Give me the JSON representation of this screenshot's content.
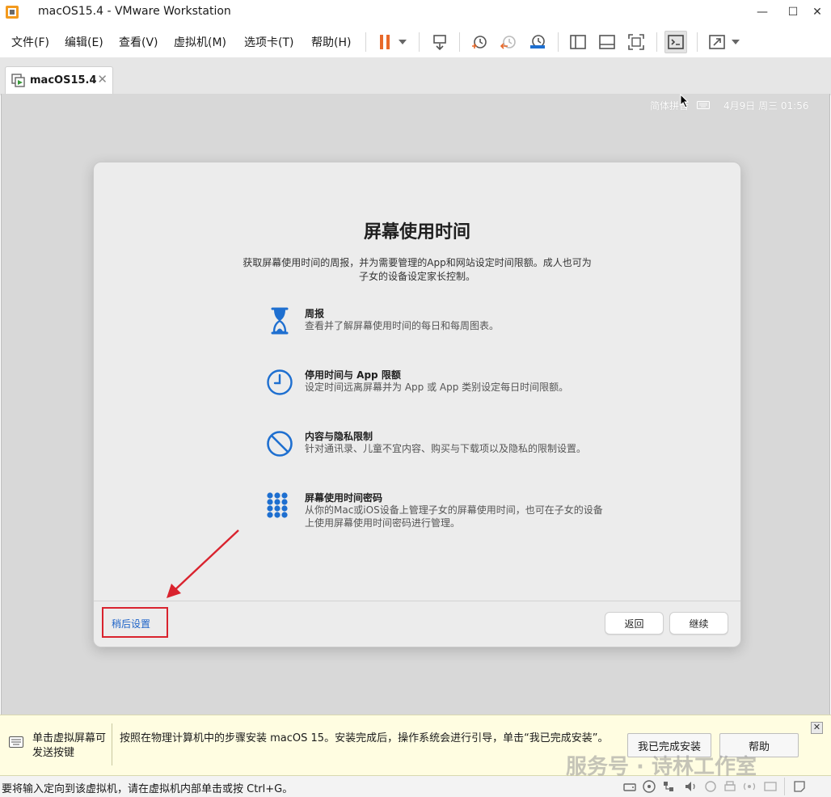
{
  "window": {
    "title": "macOS15.4 - VMware Workstation",
    "controls": {
      "minimize": "—",
      "maximize": "☐",
      "close": "✕"
    }
  },
  "menu": {
    "file": "文件(F)",
    "edit": "编辑(E)",
    "view": "查看(V)",
    "vm": "虚拟机(M)",
    "tabs": "选项卡(T)",
    "help": "帮助(H)"
  },
  "tab": {
    "label": "macOS15.4",
    "close": "✕"
  },
  "mac_status": {
    "input_method": "简体拼音",
    "datetime": "4月9日 周三 01:56"
  },
  "dialog": {
    "title": "屏幕使用时间",
    "description": "获取屏幕使用时间的周报，并为需要管理的App和网站设定时间限额。成人也可为子女的设备设定家长控制。",
    "features": [
      {
        "icon": "hourglass-icon",
        "title": "周报",
        "desc": "查看并了解屏幕使用时间的每日和每周图表。"
      },
      {
        "icon": "clock-icon",
        "title": "停用时间与 App 限额",
        "desc": "设定时间远离屏幕并为 App 或 App 类别设定每日时间限额。"
      },
      {
        "icon": "prohibited-icon",
        "title": "内容与隐私限制",
        "desc": "针对通讯录、儿童不宜内容、购买与下载项以及隐私的限制设置。"
      },
      {
        "icon": "keypad-icon",
        "title": "屏幕使用时间密码",
        "desc": "从你的Mac或iOS设备上管理子女的屏幕使用时间，也可在子女的设备上使用屏幕使用时间密码进行管理。"
      }
    ],
    "later_label": "稍后设置",
    "back_label": "返回",
    "continue_label": "继续",
    "accent_color": "#1e64c8"
  },
  "notification": {
    "left": "单击虚拟屏幕可发送按键",
    "message": "按照在物理计算机中的步骤安装 macOS 15。安装完成后，操作系统会进行引导，单击“我已完成安装”。",
    "done_button": "我已完成安装",
    "help_button": "帮助",
    "close": "✕",
    "watermark": "服务号 · 诗林工作室"
  },
  "status": {
    "text": "要将输入定向到该虚拟机，请在虚拟机内部单击或按 Ctrl+G。"
  },
  "colors": {
    "pause": "#e8692a",
    "annotation_red": "#d9232e",
    "icon_blue": "#1e6fd0"
  }
}
